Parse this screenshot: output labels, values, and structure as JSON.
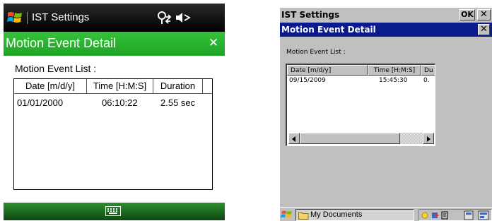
{
  "left_device": {
    "titlebar": {
      "title": "IST Settings"
    },
    "header": {
      "title": "Motion Event Detail",
      "close_glyph": "✕"
    },
    "list_label": "Motion Event List :",
    "columns": [
      "Date [m/d/y]",
      "Time [H:M:S]",
      "Duration"
    ],
    "rows": [
      {
        "date": "01/01/2000",
        "time": "06:10:22",
        "duration": "2.55 sec"
      }
    ],
    "colors": {
      "header": "#26ad2b",
      "titlebar": "#000000",
      "bottombar": "#1f6a20"
    },
    "icons": [
      "windows-flag-icon",
      "connectivity-icon",
      "volume-muted-icon",
      "close-icon",
      "keyboard-icon"
    ]
  },
  "right_device": {
    "topbar": {
      "title": "IST Settings",
      "ok_label": "OK",
      "close_glyph": "✕"
    },
    "window": {
      "title": "Motion Event Detail",
      "close_glyph": "✕"
    },
    "list_label": "Motion Event List :",
    "columns": [
      "Date [m/d/y]",
      "Time [H:M:S]",
      "Du"
    ],
    "rows": [
      {
        "date": "09/15/2009",
        "time": "15:45:30",
        "duration": "0."
      }
    ],
    "taskbar": {
      "item_label": "My Documents"
    },
    "colors": {
      "window_title": "#0a1b8e",
      "face": "#c0c0c0"
    },
    "icons": [
      "start-flag-icon",
      "folder-icon",
      "tray-icons",
      "scroll-left-icon",
      "scroll-right-icon"
    ]
  }
}
